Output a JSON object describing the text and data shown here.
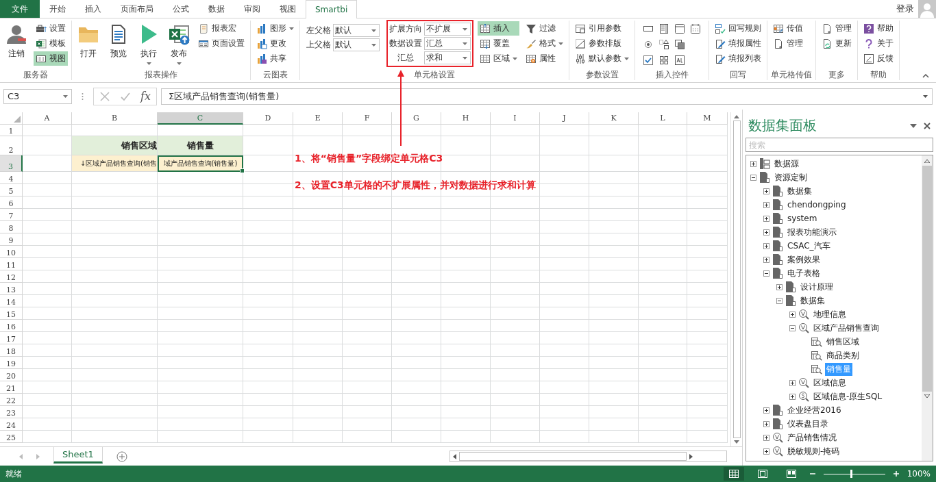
{
  "tabs": [
    {
      "label": "文件",
      "kind": "file",
      "selected": false
    },
    {
      "label": "开始",
      "kind": "tab",
      "selected": false
    },
    {
      "label": "插入",
      "kind": "tab",
      "selected": false
    },
    {
      "label": "页面布局",
      "kind": "tab",
      "selected": false
    },
    {
      "label": "公式",
      "kind": "tab",
      "selected": false
    },
    {
      "label": "数据",
      "kind": "tab",
      "selected": false
    },
    {
      "label": "审阅",
      "kind": "tab",
      "selected": false
    },
    {
      "label": "视图",
      "kind": "tab",
      "selected": false
    },
    {
      "label": "Smartbi",
      "kind": "tab",
      "selected": true
    }
  ],
  "account": {
    "label": "登录"
  },
  "ribbon": {
    "groups": [
      {
        "label": "服务器",
        "kind": "buttons",
        "columns": [
          {
            "items": [
              {
                "kind": "large",
                "label": "注销",
                "dropdown": false,
                "active": false
              }
            ]
          },
          {
            "items": [
              {
                "kind": "small",
                "label": "设置",
                "dropdown": false,
                "active": false
              },
              {
                "kind": "small",
                "label": "模板",
                "dropdown": false,
                "active": false
              },
              {
                "kind": "small",
                "label": "视图",
                "dropdown": false,
                "active": true
              }
            ]
          }
        ]
      },
      {
        "label": "报表操作",
        "kind": "buttons",
        "columns": [
          {
            "items": [
              {
                "kind": "large",
                "label": "打开",
                "dropdown": false,
                "active": false
              }
            ]
          },
          {
            "items": [
              {
                "kind": "large",
                "label": "预览",
                "dropdown": false,
                "active": false
              }
            ]
          },
          {
            "items": [
              {
                "kind": "large",
                "label": "执行",
                "dropdown": true,
                "active": false
              }
            ]
          },
          {
            "items": [
              {
                "kind": "large",
                "label": "发布",
                "dropdown": true,
                "active": false
              }
            ]
          },
          {
            "items": [
              {
                "kind": "small",
                "label": "报表宏",
                "dropdown": false,
                "active": false
              },
              {
                "kind": "small",
                "label": "页面设置",
                "dropdown": false,
                "active": false
              }
            ]
          }
        ]
      },
      {
        "label": "云图表",
        "kind": "buttons",
        "columns": [
          {
            "items": [
              {
                "kind": "small",
                "label": "图形",
                "dropdown": true,
                "active": false
              },
              {
                "kind": "small",
                "label": "更改",
                "dropdown": false,
                "active": false
              },
              {
                "kind": "small",
                "label": "共享",
                "dropdown": false,
                "active": false
              }
            ]
          }
        ]
      },
      {
        "label": "单元格设置",
        "kind": "buttons",
        "columns": [
          {
            "callout": false,
            "items": [
              {
                "kind": "combo",
                "label": "左父格",
                "value": "默认"
              },
              {
                "kind": "combo",
                "label": "上父格",
                "value": "默认"
              }
            ]
          },
          {
            "callout": true,
            "items": [
              {
                "kind": "combo",
                "label": "扩展方向",
                "value": "不扩展"
              },
              {
                "kind": "combo",
                "label": "数据设置",
                "value": "汇总"
              },
              {
                "kind": "combo",
                "label": "汇总",
                "value": "求和"
              }
            ]
          },
          {
            "callout": false,
            "items": [
              {
                "kind": "small",
                "label": "插入",
                "dropdown": false,
                "active": true
              },
              {
                "kind": "small",
                "label": "覆盖",
                "dropdown": false,
                "active": false
              },
              {
                "kind": "small",
                "label": "区域",
                "dropdown": true,
                "active": false
              }
            ]
          },
          {
            "callout": false,
            "items": [
              {
                "kind": "small",
                "label": "过滤",
                "dropdown": false,
                "active": false
              },
              {
                "kind": "small",
                "label": "格式",
                "dropdown": true,
                "active": false
              },
              {
                "kind": "small",
                "label": "属性",
                "dropdown": false,
                "active": false
              }
            ]
          }
        ]
      },
      {
        "label": "参数设置",
        "kind": "buttons",
        "columns": [
          {
            "items": [
              {
                "kind": "small",
                "label": "引用参数",
                "dropdown": false,
                "active": false
              },
              {
                "kind": "small",
                "label": "参数排版",
                "dropdown": false,
                "active": false
              },
              {
                "kind": "small",
                "label": "默认参数",
                "dropdown": true,
                "active": false
              }
            ]
          }
        ]
      },
      {
        "label": "插入控件",
        "kind": "controls"
      },
      {
        "label": "回写",
        "kind": "buttons",
        "columns": [
          {
            "items": [
              {
                "kind": "small",
                "label": "回写规则",
                "dropdown": false,
                "active": false
              },
              {
                "kind": "small",
                "label": "填报属性",
                "dropdown": false,
                "active": false
              },
              {
                "kind": "small",
                "label": "填报列表",
                "dropdown": false,
                "active": false
              }
            ]
          }
        ]
      },
      {
        "label": "单元格传值",
        "kind": "buttons",
        "columns": [
          {
            "items": [
              {
                "kind": "small",
                "label": "传值",
                "dropdown": false,
                "active": false
              },
              {
                "kind": "small",
                "label": "管理",
                "dropdown": false,
                "active": false
              }
            ]
          }
        ]
      },
      {
        "label": "更多",
        "kind": "buttons",
        "columns": [
          {
            "items": [
              {
                "kind": "small",
                "label": "管理",
                "dropdown": false,
                "active": false
              },
              {
                "kind": "small",
                "label": "更新",
                "dropdown": false,
                "active": false
              }
            ]
          }
        ]
      },
      {
        "label": "帮助",
        "kind": "buttons",
        "columns": [
          {
            "items": [
              {
                "kind": "small",
                "label": "帮助",
                "dropdown": false,
                "active": false
              },
              {
                "kind": "small",
                "label": "关于",
                "dropdown": false,
                "active": false
              },
              {
                "kind": "small",
                "label": "反馈",
                "dropdown": false,
                "active": false
              }
            ]
          }
        ]
      }
    ]
  },
  "formula_bar": {
    "cell_name": "C3",
    "function_label": "fx",
    "formula": "Σ区域产品销售查询(销售量)"
  },
  "grid": {
    "columns": [
      {
        "label": "A",
        "selected": false
      },
      {
        "label": "B",
        "selected": false
      },
      {
        "label": "C",
        "selected": true
      },
      {
        "label": "D",
        "selected": false
      },
      {
        "label": "E",
        "selected": false
      },
      {
        "label": "F",
        "selected": false
      },
      {
        "label": "G",
        "selected": false
      },
      {
        "label": "H",
        "selected": false
      },
      {
        "label": "I",
        "selected": false
      },
      {
        "label": "J",
        "selected": false
      },
      {
        "label": "K",
        "selected": false
      },
      {
        "label": "L",
        "selected": false
      },
      {
        "label": "M",
        "selected": false
      }
    ],
    "rows": [
      {
        "label": "1",
        "selected": false
      },
      {
        "label": "2",
        "selected": false,
        "cells": [
          null,
          {
            "text": "销售区域",
            "kind": "header",
            "selected": false
          },
          {
            "text": "销售量",
            "kind": "header",
            "selected": false
          }
        ]
      },
      {
        "label": "3",
        "selected": true,
        "cells": [
          null,
          {
            "text": "↓区域产品销售查询(销售",
            "kind": "field",
            "selected": false
          },
          {
            "text": "域产品销售查询(销售量)",
            "kind": "field",
            "selected": true
          }
        ]
      },
      {
        "label": "4",
        "selected": false
      },
      {
        "label": "5",
        "selected": false
      },
      {
        "label": "6",
        "selected": false
      },
      {
        "label": "7",
        "selected": false
      },
      {
        "label": "8",
        "selected": false
      },
      {
        "label": "9",
        "selected": false
      },
      {
        "label": "10",
        "selected": false
      },
      {
        "label": "11",
        "selected": false
      },
      {
        "label": "12",
        "selected": false
      },
      {
        "label": "13",
        "selected": false
      },
      {
        "label": "14",
        "selected": false
      },
      {
        "label": "15",
        "selected": false
      },
      {
        "label": "16",
        "selected": false
      },
      {
        "label": "17",
        "selected": false
      },
      {
        "label": "18",
        "selected": false
      },
      {
        "label": "19",
        "selected": false
      },
      {
        "label": "20",
        "selected": false
      },
      {
        "label": "21",
        "selected": false
      },
      {
        "label": "22",
        "selected": false
      },
      {
        "label": "23",
        "selected": false
      },
      {
        "label": "24",
        "selected": false
      },
      {
        "label": "25",
        "selected": false
      }
    ]
  },
  "annotations": [
    "1、将“销售量”字段绑定单元格C3",
    "2、设置C3单元格的不扩展属性，并对数据进行求和计算"
  ],
  "panel": {
    "title": "数据集面板",
    "search": {
      "placeholder": "搜索"
    },
    "tree": [
      {
        "label": "数据源",
        "kind": "source",
        "expanded": false,
        "selected": false
      },
      {
        "label": "资源定制",
        "kind": "folder",
        "expanded": true,
        "selected": false,
        "children": [
          {
            "label": "数据集",
            "kind": "folder",
            "expanded": false,
            "selected": false
          },
          {
            "label": "chendongping",
            "kind": "folder",
            "expanded": false,
            "selected": false
          },
          {
            "label": "system",
            "kind": "folder",
            "expanded": false,
            "selected": false
          },
          {
            "label": "报表功能演示",
            "kind": "folder",
            "expanded": false,
            "selected": false
          },
          {
            "label": "CSAC_汽车",
            "kind": "folder",
            "expanded": false,
            "selected": false
          },
          {
            "label": "案例效果",
            "kind": "folder",
            "expanded": false,
            "selected": false
          },
          {
            "label": "电子表格",
            "kind": "folder",
            "expanded": true,
            "selected": false,
            "children": [
              {
                "label": "设计原理",
                "kind": "folder",
                "expanded": false,
                "selected": false
              },
              {
                "label": "数据集",
                "kind": "folder",
                "expanded": true,
                "selected": false,
                "children": [
                  {
                    "label": "地理信息",
                    "kind": "query",
                    "expanded": false,
                    "selected": false
                  },
                  {
                    "label": "区域产品销售查询",
                    "kind": "query",
                    "expanded": true,
                    "selected": false,
                    "children": [
                      {
                        "label": "销售区域",
                        "kind": "field",
                        "selected": false
                      },
                      {
                        "label": "商品类别",
                        "kind": "field",
                        "selected": false
                      },
                      {
                        "label": "销售量",
                        "kind": "field",
                        "selected": true
                      }
                    ]
                  },
                  {
                    "label": "区域信息",
                    "kind": "query",
                    "expanded": false,
                    "selected": false
                  },
                  {
                    "label": "区域信息-原生SQL",
                    "kind": "sql",
                    "expanded": false,
                    "selected": false
                  }
                ]
              }
            ]
          },
          {
            "label": "企业经营2016",
            "kind": "folder",
            "expanded": false,
            "selected": false
          },
          {
            "label": "仪表盘目录",
            "kind": "folder",
            "expanded": false,
            "selected": false
          },
          {
            "label": "产品销售情况",
            "kind": "query",
            "expanded": false,
            "selected": false
          },
          {
            "label": "脱敏规则-掩码",
            "kind": "query",
            "expanded": false,
            "selected": false
          }
        ]
      }
    ]
  },
  "sheet_tabs": [
    {
      "label": "Sheet1",
      "selected": true
    }
  ],
  "status_bar": {
    "text": "就绪",
    "zoom": {
      "level": 0.45,
      "reading": "100%"
    }
  }
}
